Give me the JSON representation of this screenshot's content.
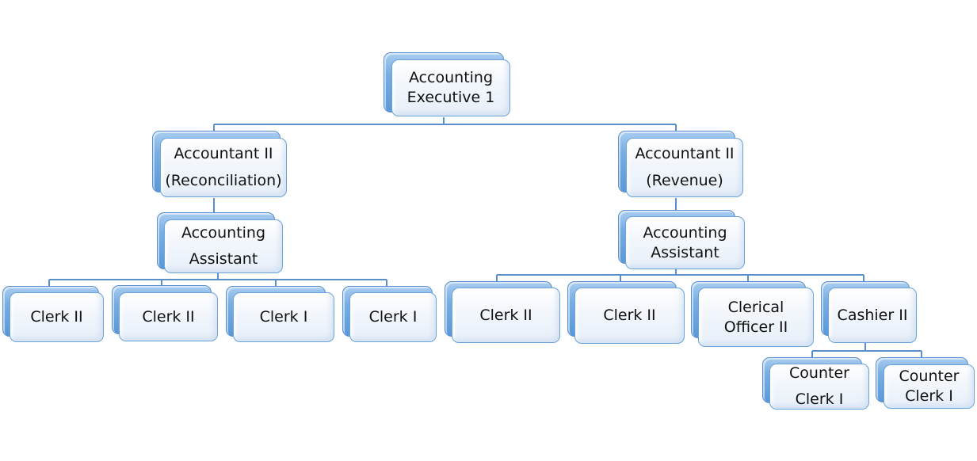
{
  "diagram": {
    "type": "org-chart",
    "connector_color": "#5a8fcc",
    "box_accent_color": "#5b98d8",
    "nodes": {
      "exec": {
        "lines": [
          "Accounting",
          "Executive 1"
        ]
      },
      "acct_recon": {
        "lines": [
          "Accountant II",
          "(Reconciliation)"
        ]
      },
      "asst_left": {
        "lines": [
          "Accounting",
          "Assistant"
        ]
      },
      "clerk_l1": {
        "lines": [
          "Clerk II"
        ]
      },
      "clerk_l2": {
        "lines": [
          "Clerk II"
        ]
      },
      "clerk_l3": {
        "lines": [
          "Clerk I"
        ]
      },
      "clerk_l4": {
        "lines": [
          "Clerk I"
        ]
      },
      "acct_rev": {
        "lines": [
          "Accountant II",
          "(Revenue)"
        ]
      },
      "asst_right": {
        "lines": [
          "Accounting",
          "Assistant"
        ]
      },
      "clerk_r1": {
        "lines": [
          "Clerk II"
        ]
      },
      "clerk_r2": {
        "lines": [
          "Clerk II"
        ]
      },
      "clerical": {
        "lines": [
          "Clerical",
          "Officer II"
        ]
      },
      "cashier": {
        "lines": [
          "Cashier II"
        ]
      },
      "counter1": {
        "lines": [
          "Counter",
          "Clerk I"
        ]
      },
      "counter2": {
        "lines": [
          "Counter",
          "Clerk I"
        ]
      }
    },
    "hierarchy": [
      {
        "id": "exec",
        "children": [
          "acct_recon",
          "acct_rev"
        ]
      },
      {
        "id": "acct_recon",
        "children": [
          "asst_left"
        ]
      },
      {
        "id": "asst_left",
        "children": [
          "clerk_l1",
          "clerk_l2",
          "clerk_l3",
          "clerk_l4"
        ]
      },
      {
        "id": "acct_rev",
        "children": [
          "asst_right"
        ]
      },
      {
        "id": "asst_right",
        "children": [
          "clerk_r1",
          "clerk_r2",
          "clerical",
          "cashier"
        ]
      },
      {
        "id": "cashier",
        "children": [
          "counter1",
          "counter2"
        ]
      }
    ]
  }
}
